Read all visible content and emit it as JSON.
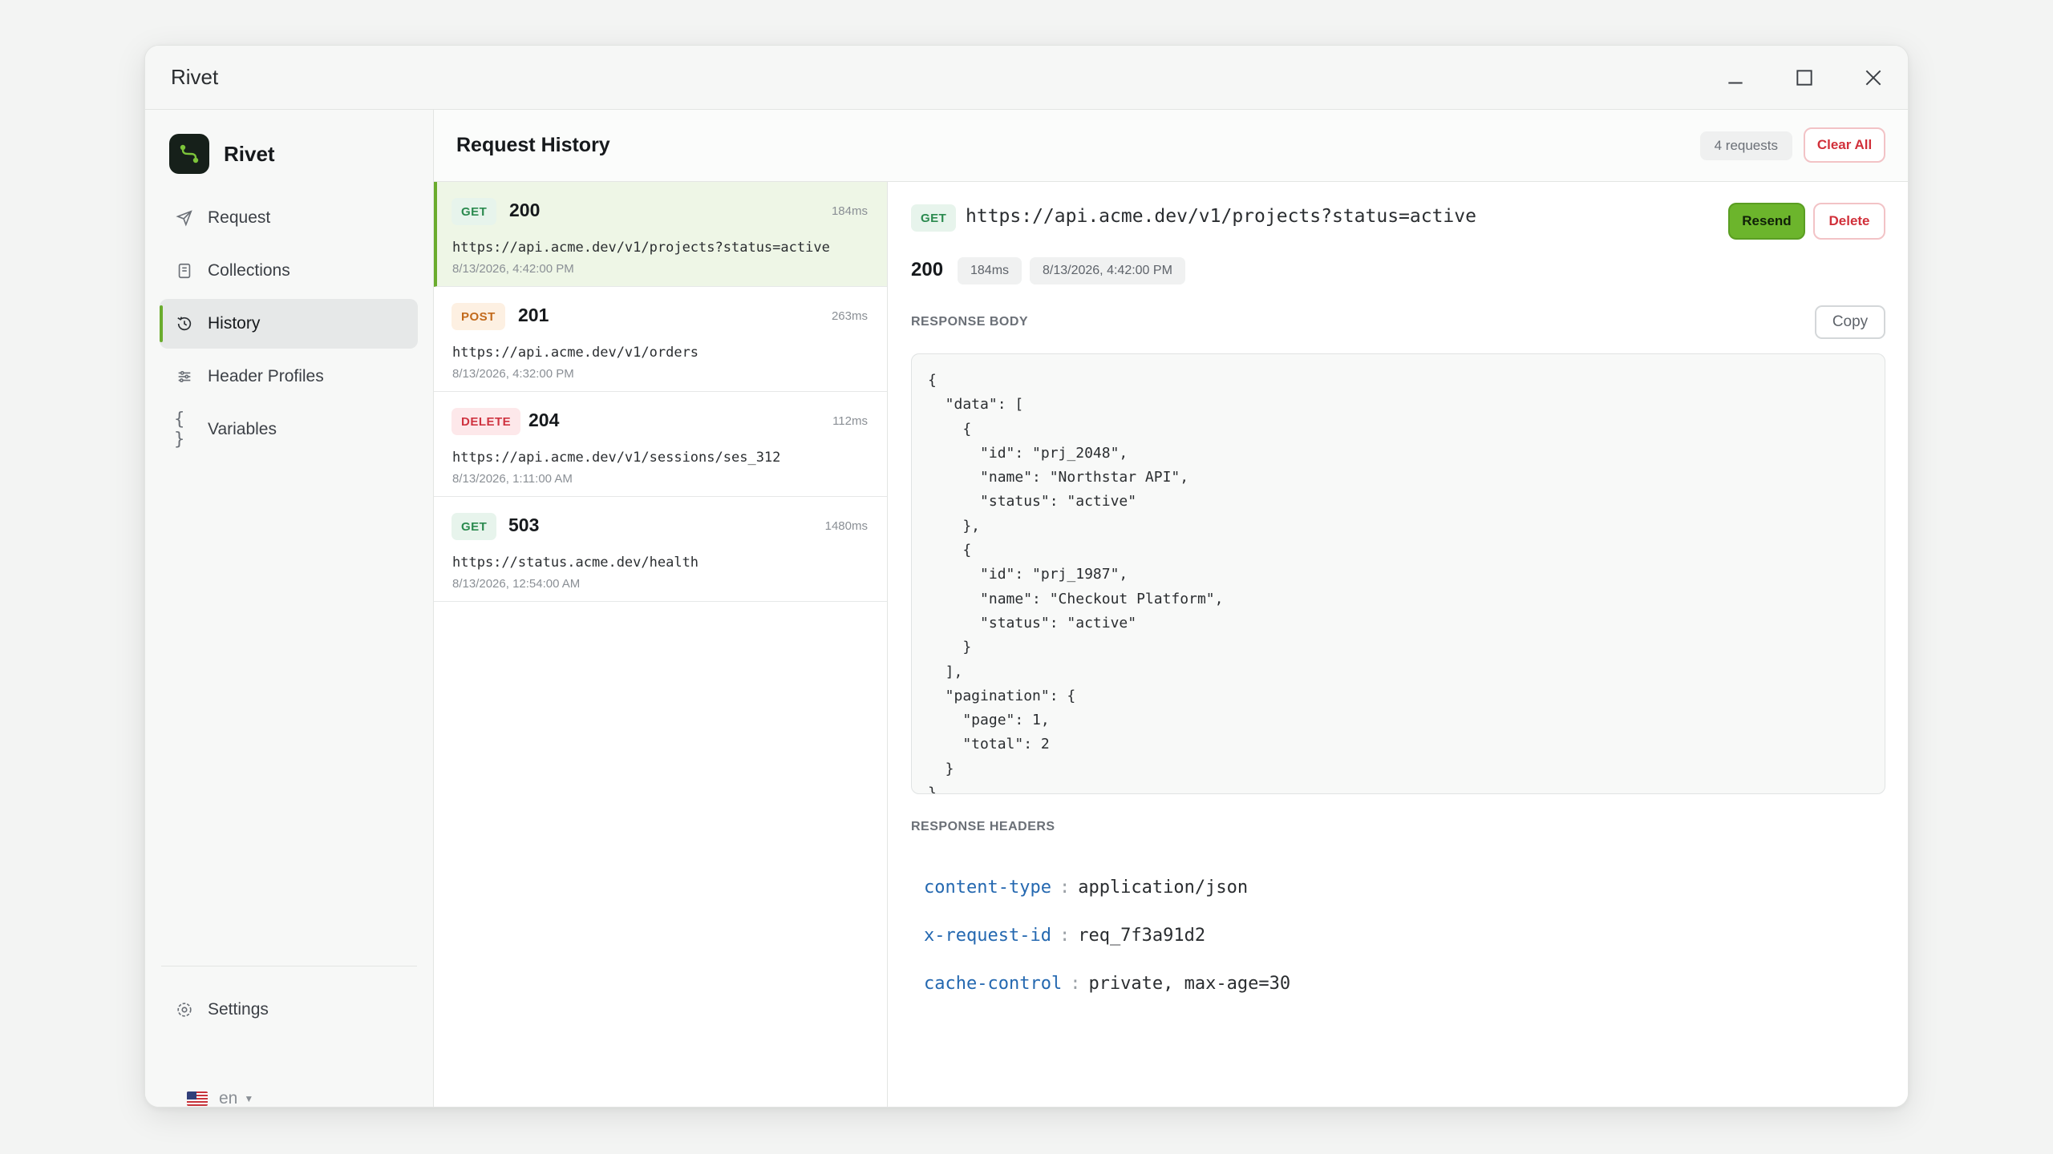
{
  "window": {
    "title": "Rivet"
  },
  "sidebar": {
    "brand": "Rivet",
    "items": [
      {
        "label": "Request",
        "icon": "send-icon"
      },
      {
        "label": "Collections",
        "icon": "collections-icon"
      },
      {
        "label": "History",
        "icon": "history-icon",
        "active": true
      },
      {
        "label": "Header Profiles",
        "icon": "sliders-icon"
      },
      {
        "label": "Variables",
        "icon": "braces-icon"
      }
    ],
    "settings_label": "Settings",
    "language": "en"
  },
  "main": {
    "title": "Request History",
    "count_label": "4 requests",
    "clear_label": "Clear All"
  },
  "requests": [
    {
      "method": "GET",
      "status": "200",
      "time": "184ms",
      "url": "https://api.acme.dev/v1/projects?status=active",
      "date": "8/13/2026, 4:42:00 PM",
      "selected": true
    },
    {
      "method": "POST",
      "status": "201",
      "time": "263ms",
      "url": "https://api.acme.dev/v1/orders",
      "date": "8/13/2026, 4:32:00 PM"
    },
    {
      "method": "DELETE",
      "status": "204",
      "time": "112ms",
      "url": "https://api.acme.dev/v1/sessions/ses_312",
      "date": "8/13/2026, 1:11:00 AM"
    },
    {
      "method": "GET",
      "status": "503",
      "time": "1480ms",
      "url": "https://status.acme.dev/health",
      "date": "8/13/2026, 12:54:00 AM"
    }
  ],
  "detail": {
    "method": "GET",
    "url": "https://api.acme.dev/v1/projects?status=active",
    "resend_label": "Resend",
    "delete_label": "Delete",
    "status": "200",
    "time": "184ms",
    "date": "8/13/2026, 4:42:00 PM",
    "body_label": "RESPONSE BODY",
    "copy_label": "Copy",
    "body": "{\n  \"data\": [\n    {\n      \"id\": \"prj_2048\",\n      \"name\": \"Northstar API\",\n      \"status\": \"active\"\n    },\n    {\n      \"id\": \"prj_1987\",\n      \"name\": \"Checkout Platform\",\n      \"status\": \"active\"\n    }\n  ],\n  \"pagination\": {\n    \"page\": 1,\n    \"total\": 2\n  }\n}",
    "headers_label": "RESPONSE HEADERS",
    "headers": [
      {
        "key": "content-type",
        "value": "application/json"
      },
      {
        "key": "x-request-id",
        "value": "req_7f3a91d2"
      },
      {
        "key": "cache-control",
        "value": "private, max-age=30"
      }
    ]
  }
}
